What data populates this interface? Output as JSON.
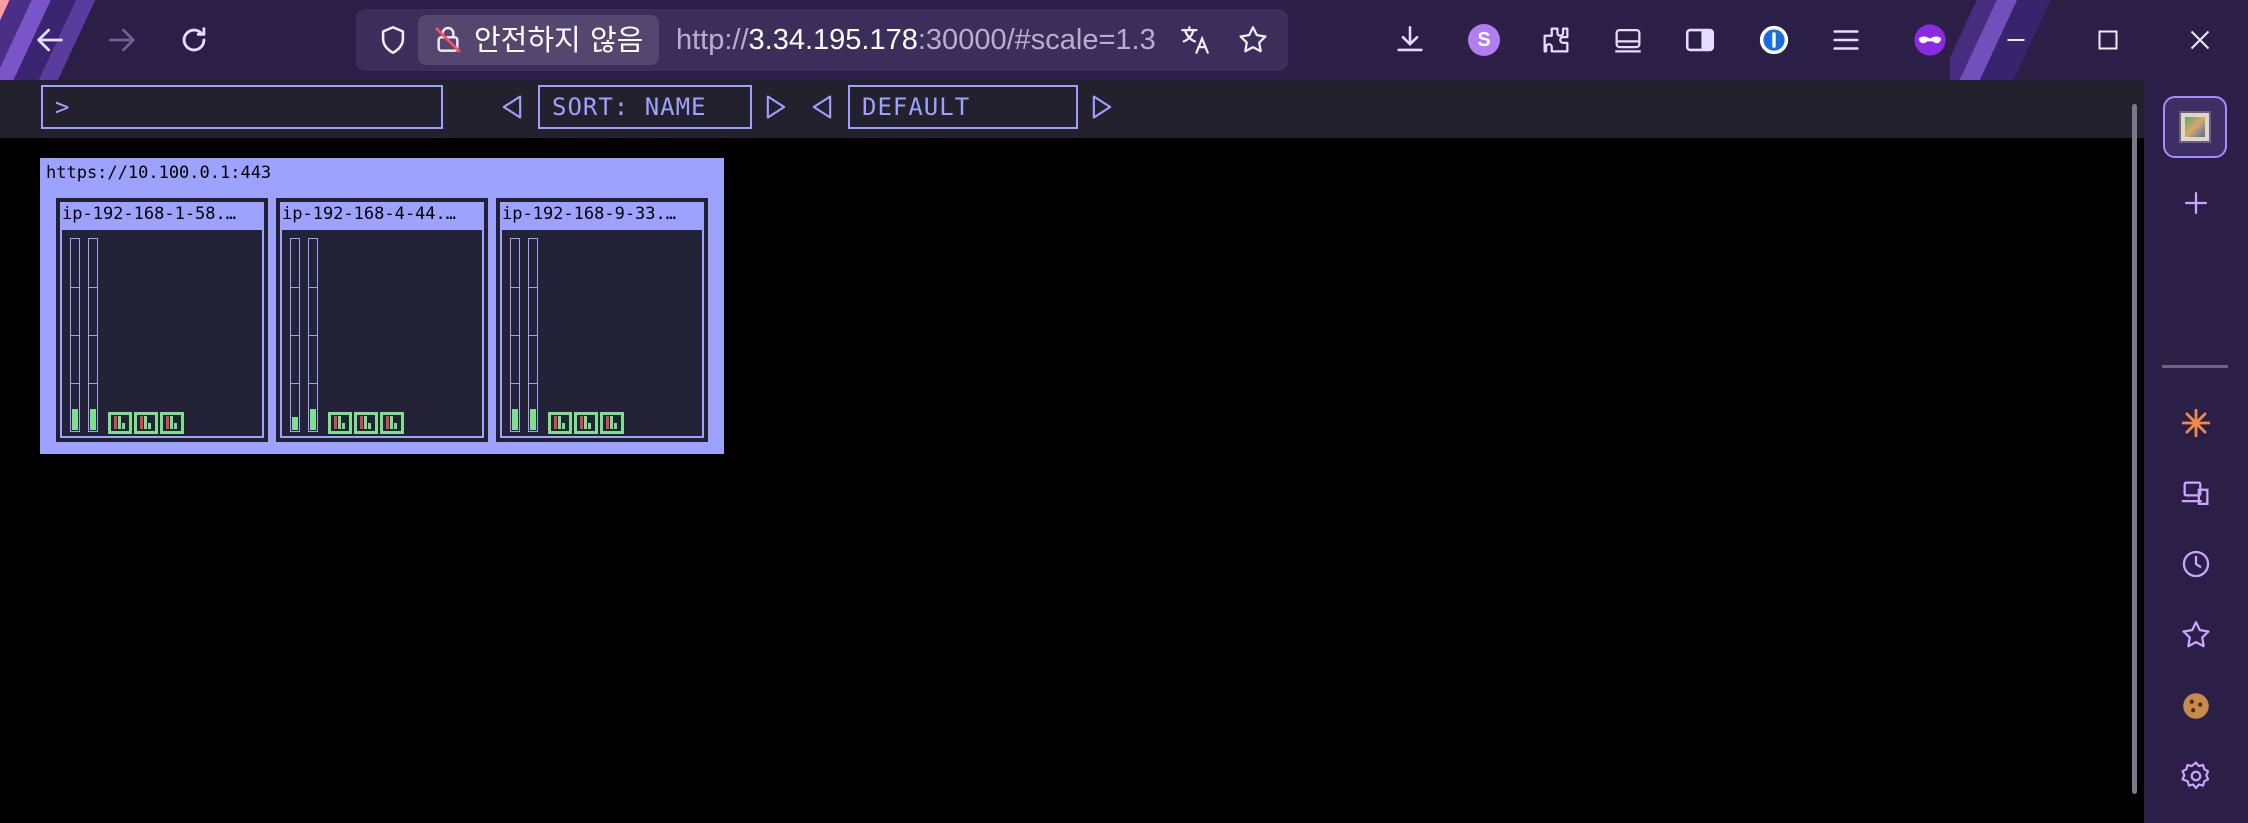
{
  "browser": {
    "security_label": "안전하지 않음",
    "url_prefix": "http://",
    "url_host": "3.34.195.178",
    "url_rest": ":30000/#scale=1.3",
    "toolbar_icons": [
      "download-icon",
      "account-s-icon",
      "extensions-icon",
      "sidebar-toggle-icon",
      "reader-icon",
      "password-manager-icon",
      "menu-icon",
      "private-mask-icon"
    ],
    "account_letter": "S",
    "colors": {
      "chrome_bg": "#2b1f47",
      "urlbar_bg": "#3b2e5a",
      "accent": "#a88bff"
    }
  },
  "sidebar": {
    "items": [
      "tab-thumbnail",
      "add-icon",
      "sparkle-icon",
      "devices-icon",
      "history-icon",
      "bookmarks-icon",
      "cookie-icon",
      "settings-icon"
    ]
  },
  "app": {
    "filter_prompt": ">",
    "sort_label": "SORT: NAME",
    "mode_label": "DEFAULT",
    "colors": {
      "accent": "#9ea2ff",
      "panel_bg": "#242237",
      "ok": "#7ee08a",
      "warn": "#d04a4a"
    }
  },
  "cluster": {
    "title": "https://10.100.0.1:443",
    "nodes": [
      {
        "name": "ip-192-168-1-58.…",
        "cpu": 0.11,
        "mem": 0.11,
        "pods": 3
      },
      {
        "name": "ip-192-168-4-44.…",
        "cpu": 0.07,
        "mem": 0.11,
        "pods": 3
      },
      {
        "name": "ip-192-168-9-33.…",
        "cpu": 0.11,
        "mem": 0.11,
        "pods": 3
      }
    ]
  }
}
